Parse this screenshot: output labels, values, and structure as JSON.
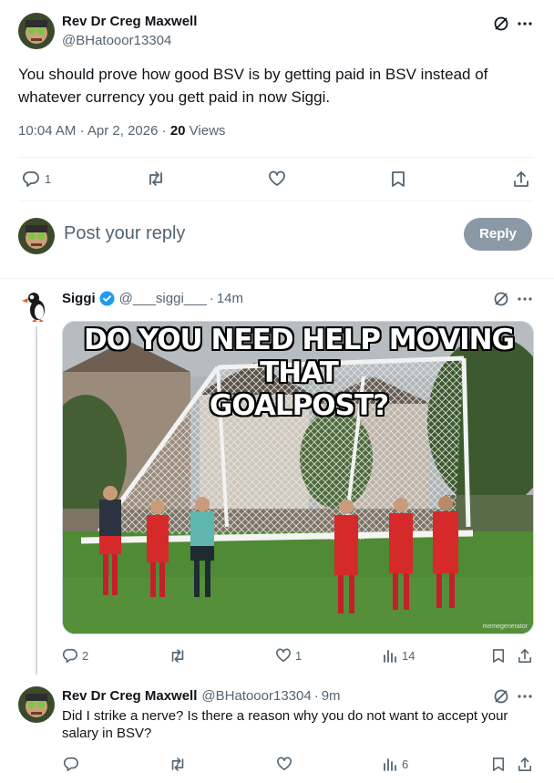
{
  "main_tweet": {
    "author_name": "Rev Dr Creg Maxwell",
    "author_handle": "@BHatooor13304",
    "text_line1": "You should prove how good BSV is by getting paid in BSV instead of",
    "text_line2": "whatever currency you gett paid in now Siggi.",
    "time": "10:04 AM",
    "date": "Apr 2, 2026",
    "views_count": "20",
    "views_label": "Views",
    "reply_count": "1"
  },
  "composer": {
    "placeholder": "Post your reply",
    "reply_button": "Reply"
  },
  "reply1": {
    "author_name": "Siggi",
    "author_handle": "@___siggi___",
    "time": "14m",
    "meme_line1": "DO YOU NEED HELP MOVING THAT",
    "meme_line2": "GOALPOST?",
    "watermark": "memegenerator",
    "reply_count": "2",
    "like_count": "1",
    "views_count": "14"
  },
  "reply2": {
    "author_name": "Rev Dr Creg Maxwell",
    "author_handle": "@BHatooor13304",
    "time": "9m",
    "text_line1": "Did I strike a nerve? Is there a reason why you do not want to accept your",
    "text_line2": "salary in BSV?",
    "views_count": "6"
  },
  "colors": {
    "text": "#0f1419",
    "muted": "#536471",
    "verified": "#1d9bf0",
    "reply_button_bg": "#8b98a5",
    "divider": "#eff3f4"
  }
}
